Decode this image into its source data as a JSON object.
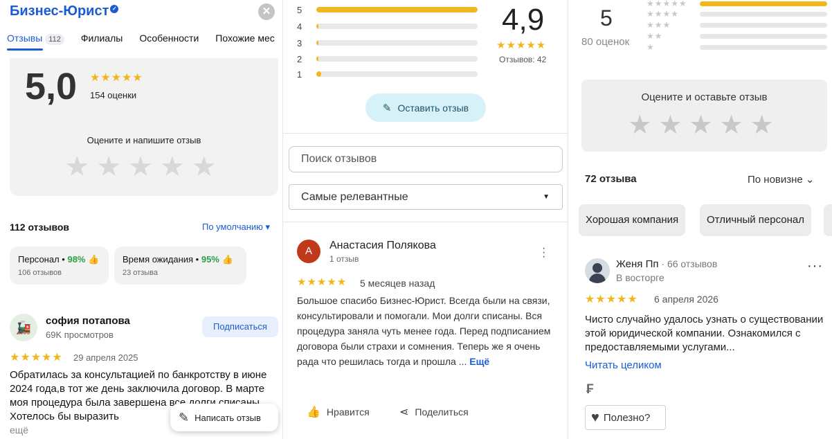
{
  "panel1": {
    "title": "Бизнес-Юрист",
    "verified_glyph": "✓",
    "close_glyph": "✕",
    "tabs": [
      {
        "label": "Отзывы",
        "badge": "112"
      },
      {
        "label": "Филиалы"
      },
      {
        "label": "Особенности"
      },
      {
        "label": "Похожие мес"
      }
    ],
    "rating": "5,0",
    "stars": "★★★★★",
    "count_text": "154 оценки",
    "rate_prompt": "Оцените и напишите отзыв",
    "empty_stars": "★★★★★",
    "reviews_count": "112 отзывов",
    "sort_label": "По умолчанию ▾",
    "chips": [
      {
        "title": "Персонал",
        "pct": "98%",
        "sub": "106 отзывов"
      },
      {
        "title": "Время ожидания",
        "pct": "95%",
        "sub": "23 отзыва"
      }
    ],
    "review": {
      "author": "софия потапова",
      "views": "69K просмотров",
      "subscribe": "Подписаться",
      "stars": "★★★★★",
      "date": "29 апреля 2025",
      "text": "Обратилась за консультацией по банкротству в июне 2024 года,в тот же день заключила договор. В марте моя процедура была завершена все долги списаны. Хотелось бы выразить",
      "more": "ещё"
    },
    "write_button": "Написать отзыв"
  },
  "panel2": {
    "bars": [
      {
        "label": "5",
        "fill": 1.0
      },
      {
        "label": "4",
        "fill": 0.0
      },
      {
        "label": "3",
        "fill": 0.0
      },
      {
        "label": "2",
        "fill": 0.0
      },
      {
        "label": "1",
        "fill": 0.0
      }
    ],
    "rating": "4,9",
    "stars": "★★★★★",
    "count": "Отзывов: 42",
    "leave_button": "Оставить отзыв",
    "search_placeholder": "Поиск отзывов",
    "sort_label": "Самые релевантные",
    "caret": "▼",
    "review": {
      "avatar_letter": "А",
      "author": "Анастасия Полякова",
      "count": "1 отзыв",
      "stars": "★★★★★",
      "date": "5 месяцев назад",
      "text": "Большое спасибо Бизнес-Юрист. Всегда были на связи, консультировали и помогали. Мои долги списаны.  Вся процедура заняла чуть менее года. Перед подписанием договора были страхи и сомнения. Теперь же я очень рада что решилась тогда и прошла ...",
      "more": "Ещё"
    },
    "like_label": "Нравится",
    "share_label": "Поделиться"
  },
  "panel3": {
    "rating": "5",
    "count": "80 оценок",
    "star_rows": [
      "★★★★★",
      "★★★★",
      "★★★",
      "★★",
      "★"
    ],
    "bar_fills": [
      1.0,
      0.0,
      0.0,
      0.0,
      0.0
    ],
    "rate_prompt": "Оцените и оставьте отзыв",
    "empty_stars": "★★★★★",
    "reviews_count": "72 отзыва",
    "sort_label": "По новизне ⌄",
    "chips": [
      "Хорошая компания",
      "Отличный персонал",
      ""
    ],
    "review": {
      "author": "Женя Пп",
      "count": " · 66 отзывов",
      "badge": "В восторге",
      "stars": "★★★★★",
      "date": "6 апреля 2026",
      "text": "Чисто случайно удалось узнать о существовании этой юридической компании. Ознакомился с предоставляемыми услугами...",
      "read_more": "Читать целиком"
    },
    "useful_label": "Полезно?"
  },
  "colors": {
    "accent_blue": "#1a5cd6",
    "star_yellow": "#f2b51c",
    "positive_green": "#2aa245"
  }
}
